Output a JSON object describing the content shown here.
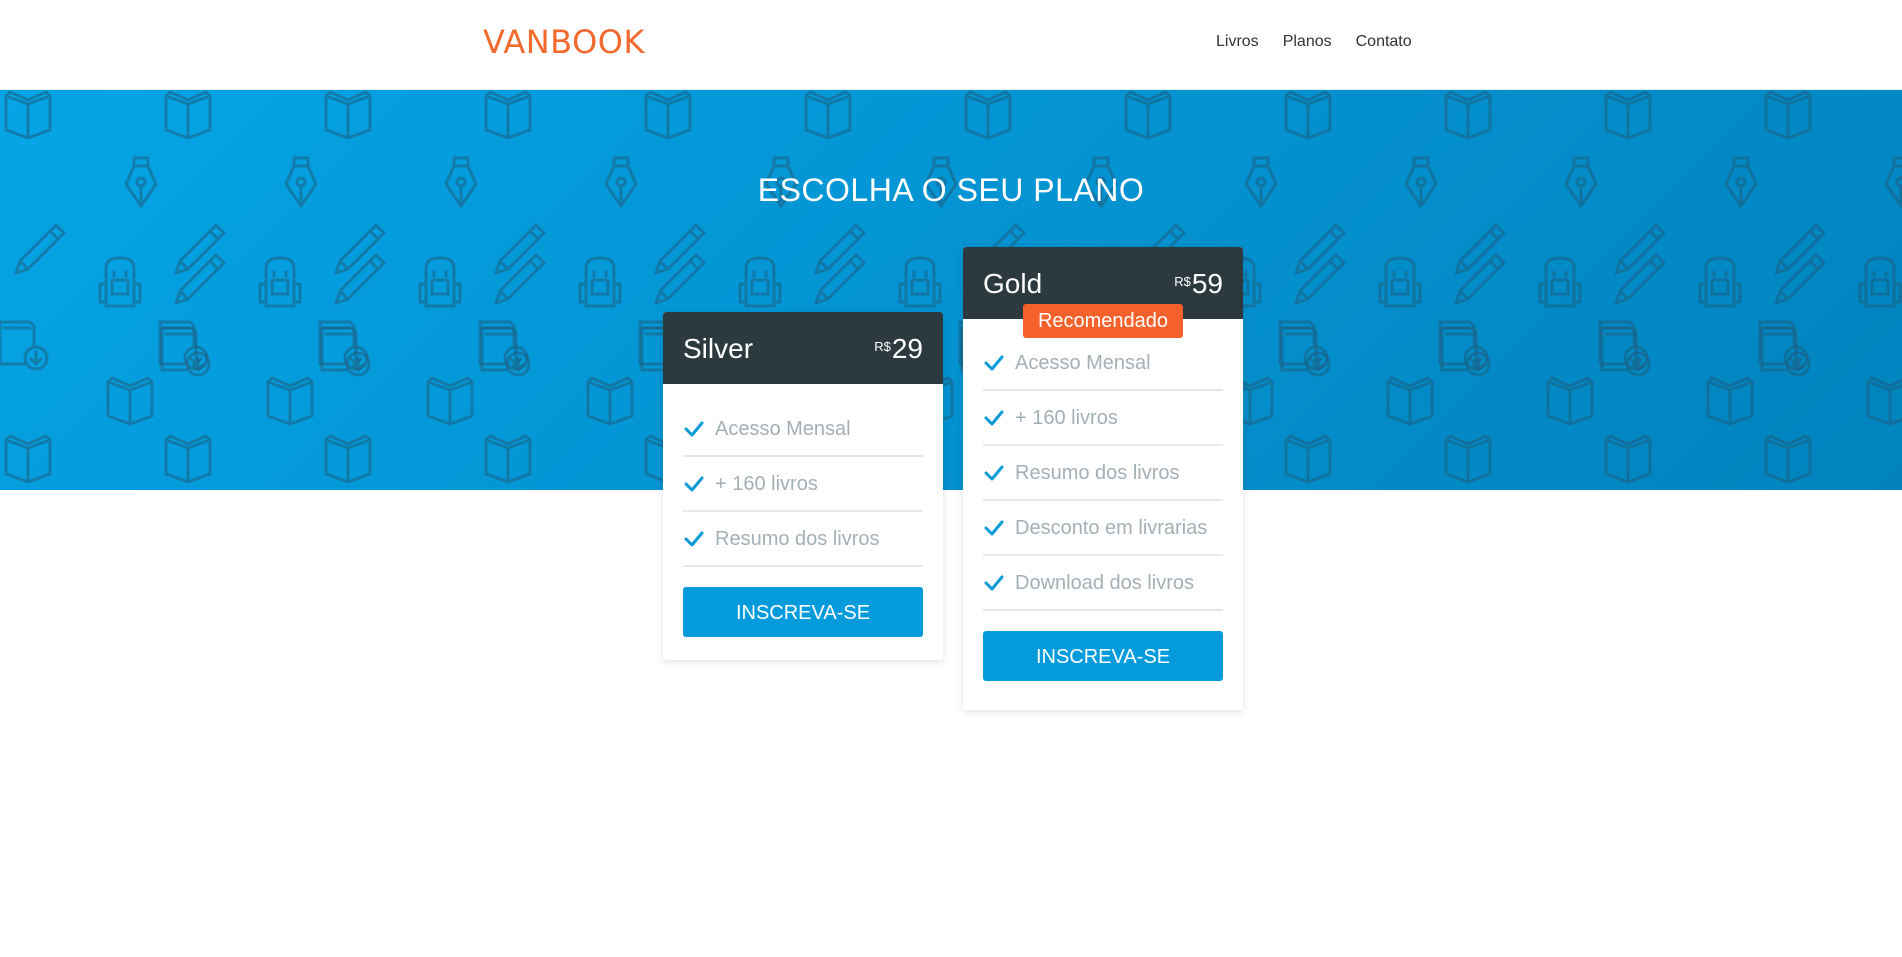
{
  "header": {
    "logo": "VANBOOK",
    "nav": [
      "Livros",
      "Planos",
      "Contato"
    ]
  },
  "hero": {
    "title": "ESCOLHA O SEU PLANO"
  },
  "plans": [
    {
      "name": "Silver",
      "currency": "R$",
      "price": "29",
      "features": [
        "Acesso Mensal",
        "+ 160 livros",
        "Resumo dos livros"
      ],
      "button": "INSCREVA-SE"
    },
    {
      "name": "Gold",
      "currency": "R$",
      "price": "59",
      "badge": "Recomendado",
      "features": [
        "Acesso Mensal",
        "+ 160 livros",
        "Resumo dos livros",
        "Desconto em livrarias",
        "Download dos livros"
      ],
      "button": "INSCREVA-SE"
    }
  ],
  "colors": {
    "brand": "#f26a2e",
    "primary": "#049bdd",
    "dark": "#2c3a40",
    "badge": "#f5612a"
  },
  "icons": {
    "feature": "check-icon",
    "pattern": [
      "open-book-icon",
      "fountain-pen-icon",
      "pencil-icon",
      "backpack-icon",
      "book-download-icon"
    ]
  }
}
